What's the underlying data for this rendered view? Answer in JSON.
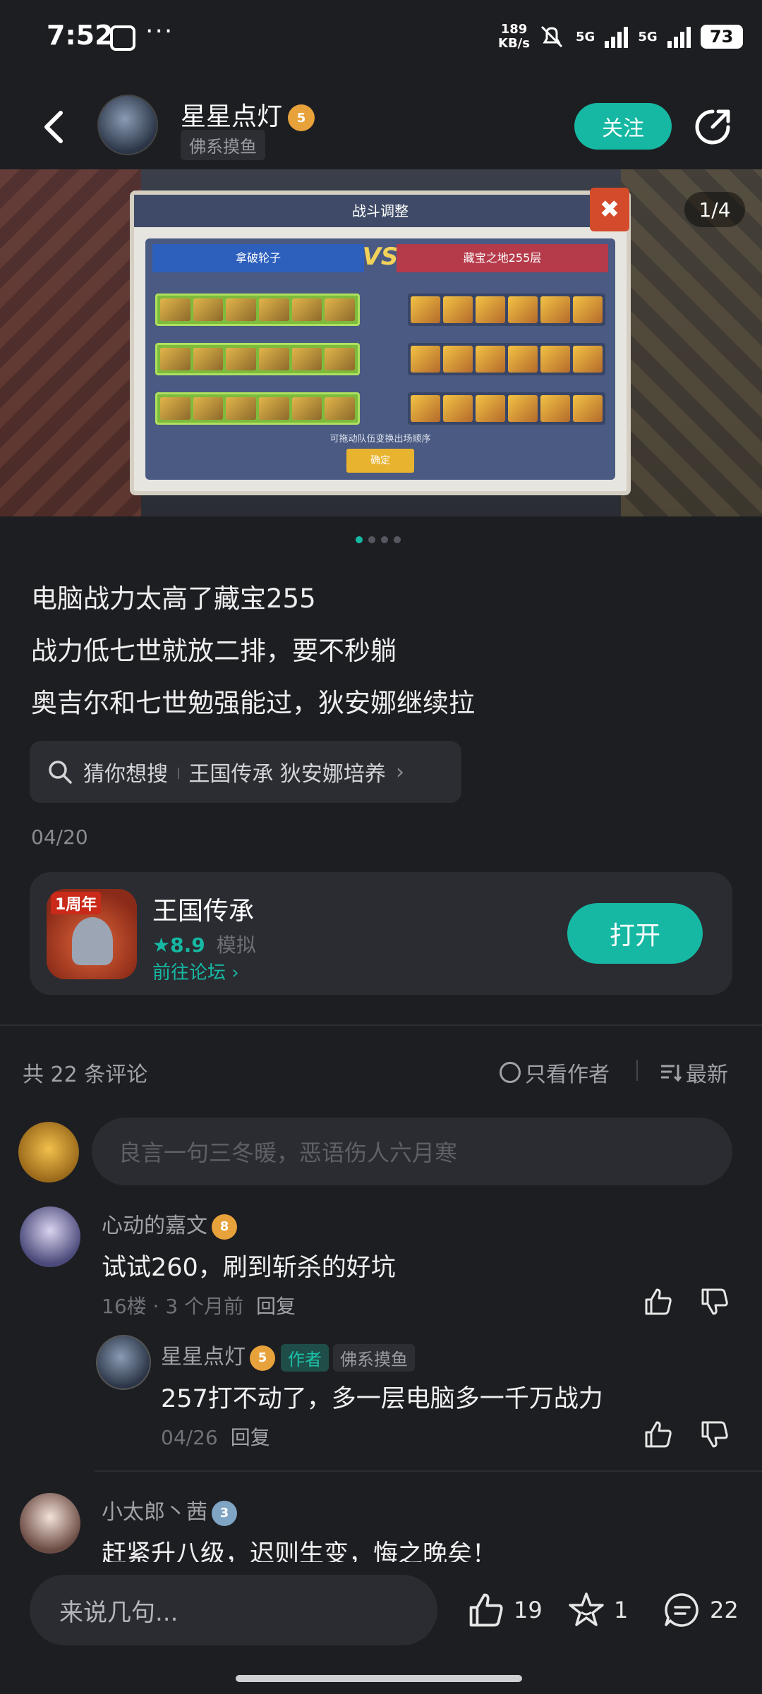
{
  "status": {
    "time": "7:52",
    "dots": "···",
    "speed_top": "189",
    "speed_bottom": "KB/s",
    "signal1": "5G",
    "signal2": "5G",
    "battery": "73"
  },
  "header": {
    "username": "星星点灯",
    "level": "5",
    "user_tag": "佛系摸鱼",
    "follow_label": "关注"
  },
  "hero": {
    "page_counter": "1/4",
    "dialog_title": "战斗调整",
    "left_team": "拿破轮子",
    "right_team": "藏宝之地255层",
    "vs": "VS",
    "hint": "可拖动队伍变换出场顺序",
    "ok": "确定",
    "page_count": 4,
    "current_page": 1
  },
  "post": {
    "line1": "电脑战力太高了藏宝255",
    "line2": "战力低七世就放二排，要不秒躺",
    "line3": "奥吉尔和七世勉强能过，狄安娜继续拉",
    "search_prefix": "猜你想搜",
    "search_query": "王国传承 狄安娜培养",
    "date": "04/20"
  },
  "app": {
    "name": "王国传承",
    "anniversary": "1周年",
    "rating": "8.9",
    "genre": "模拟",
    "forum_link": "前往论坛",
    "open_label": "打开"
  },
  "comments": {
    "count_label": "共 22 条评论",
    "only_author": "只看作者",
    "sort": "最新",
    "input_placeholder": "良言一句三冬暖，恶语伤人六月寒",
    "items": [
      {
        "name": "心动的嘉文",
        "level": "8",
        "body": "试试260，刷到斩杀的好坑",
        "floor": "16楼 · 3 个月前",
        "reply": "回复"
      },
      {
        "name": "星星点灯",
        "level": "5",
        "author_tag": "作者",
        "user_tag": "佛系摸鱼",
        "body": "257打不动了，多一层电脑多一千万战力",
        "meta": "04/26",
        "reply": "回复"
      },
      {
        "name": "小太郎丶茜",
        "level": "3",
        "body": "赶紧升八级，迟则生变，悔之晚矣！"
      }
    ]
  },
  "bottom": {
    "say_placeholder": "来说几句...",
    "likes": "19",
    "favorites": "1",
    "comments": "22"
  },
  "colors": {
    "accent": "#16b8a3",
    "background": "#1d1e22",
    "card": "#2a2c31"
  }
}
